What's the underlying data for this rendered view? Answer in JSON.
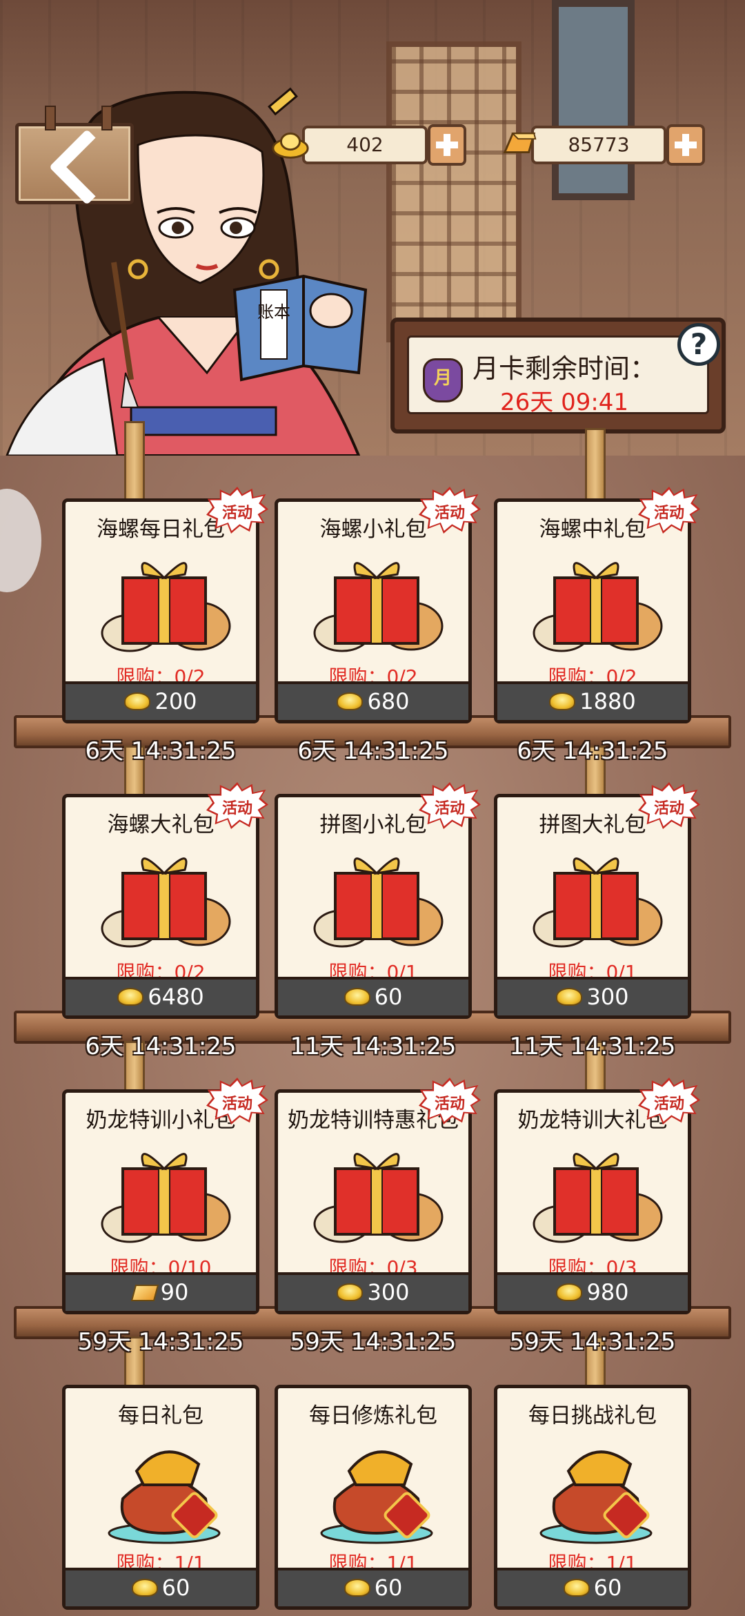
{
  "header": {
    "back_label": "",
    "currency_gold": "402",
    "currency_ingot": "85773"
  },
  "book_label": "账本",
  "month_card": {
    "badge": "月",
    "title": "月卡剩余时间：",
    "remaining": "26天 09:41",
    "help": "?"
  },
  "badge_label": "活动",
  "packs": [
    {
      "name": "海螺每日礼包",
      "limit": "限购：0/2",
      "price": "200",
      "currency": "gold",
      "timer": "6天 14:31:25",
      "activity": true
    },
    {
      "name": "海螺小礼包",
      "limit": "限购：0/2",
      "price": "680",
      "currency": "gold",
      "timer": "6天 14:31:25",
      "activity": true
    },
    {
      "name": "海螺中礼包",
      "limit": "限购：0/2",
      "price": "1880",
      "currency": "gold",
      "timer": "6天 14:31:25",
      "activity": true
    },
    {
      "name": "海螺大礼包",
      "limit": "限购：0/2",
      "price": "6480",
      "currency": "gold",
      "timer": "6天 14:31:25",
      "activity": true
    },
    {
      "name": "拼图小礼包",
      "limit": "限购：0/1",
      "price": "60",
      "currency": "gold",
      "timer": "11天 14:31:25",
      "activity": true
    },
    {
      "name": "拼图大礼包",
      "limit": "限购：0/1",
      "price": "300",
      "currency": "gold",
      "timer": "11天 14:31:25",
      "activity": true
    },
    {
      "name": "奶龙特训小礼包",
      "limit": "限购：0/10",
      "price": "90",
      "currency": "ingot",
      "timer": "59天 14:31:25",
      "activity": true
    },
    {
      "name": "奶龙特训特惠礼包",
      "limit": "限购：0/3",
      "price": "300",
      "currency": "gold",
      "timer": "59天 14:31:25",
      "activity": true
    },
    {
      "name": "奶龙特训大礼包",
      "limit": "限购：0/3",
      "price": "980",
      "currency": "gold",
      "timer": "59天 14:31:25",
      "activity": true
    },
    {
      "name": "每日礼包",
      "limit": "限购：1/1",
      "price": "60",
      "currency": "gold",
      "timer": "",
      "activity": false
    },
    {
      "name": "每日修炼礼包",
      "limit": "限购：1/1",
      "price": "60",
      "currency": "gold",
      "timer": "",
      "activity": false
    },
    {
      "name": "每日挑战礼包",
      "limit": "限购：1/1",
      "price": "60",
      "currency": "gold",
      "timer": "",
      "activity": false
    }
  ],
  "colors": {
    "limit_red": "#e12b24",
    "timer_red": "#e0231d",
    "price_bar": "#4a4a4a",
    "card_bg": "#fbf3e4"
  }
}
